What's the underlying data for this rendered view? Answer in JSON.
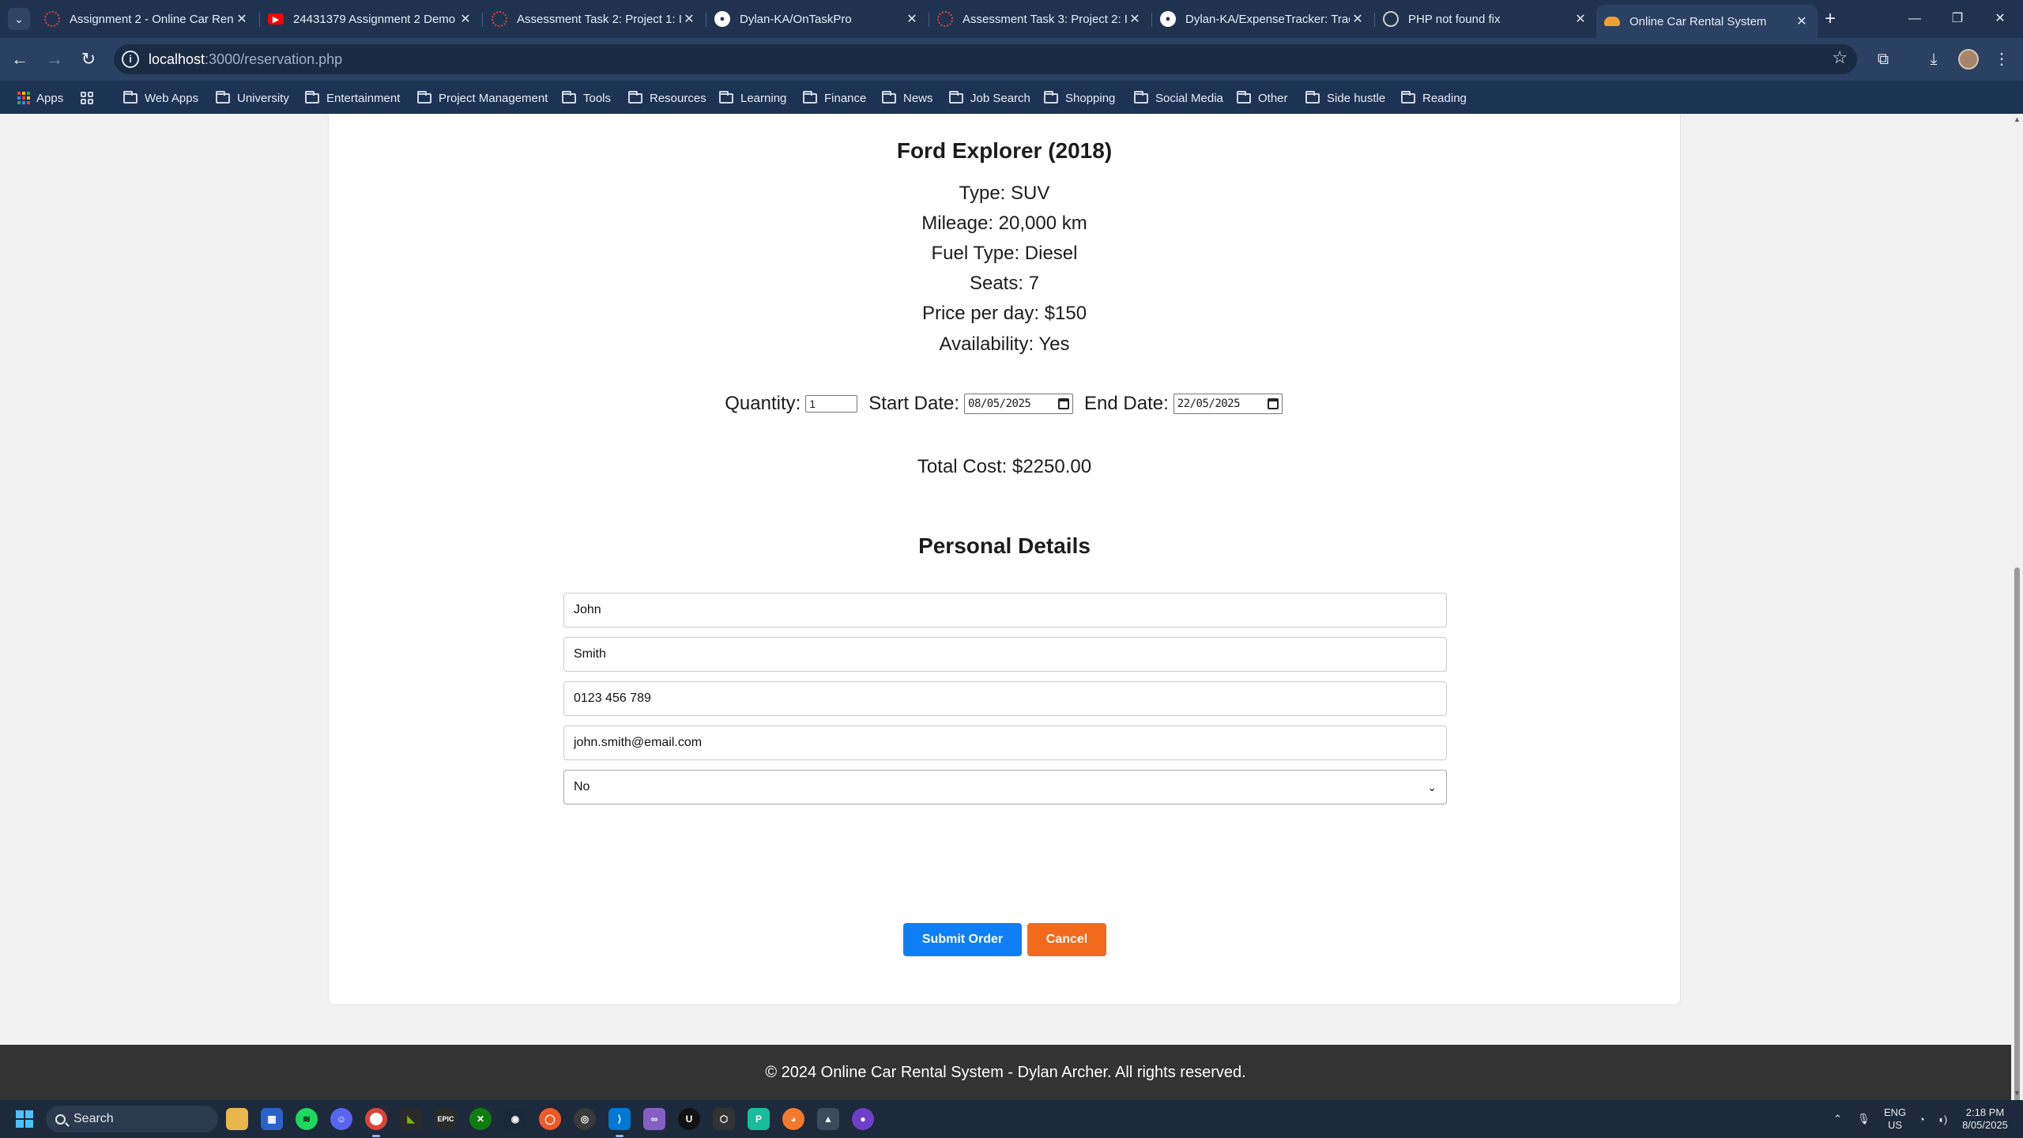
{
  "browser": {
    "tabs": [
      {
        "label": "Assignment 2 - Online Car Ren",
        "icon": "spinner-icon",
        "color": "#e04040"
      },
      {
        "label": "24431379 Assignment 2 Demo",
        "icon": "youtube-icon",
        "color": "#ff0000"
      },
      {
        "label": "Assessment Task 2: Project 1: I",
        "icon": "spinner-icon",
        "color": "#e04040"
      },
      {
        "label": "Dylan-KA/OnTaskPro",
        "icon": "github-icon",
        "color": "#ffffff"
      },
      {
        "label": "Assessment Task 3: Project 2: I",
        "icon": "spinner-icon",
        "color": "#e04040"
      },
      {
        "label": "Dylan-KA/ExpenseTracker: Trac",
        "icon": "github-icon",
        "color": "#ffffff"
      },
      {
        "label": "PHP not found fix",
        "icon": "chatgpt-icon",
        "color": "#cccccc"
      },
      {
        "label": "Online Car Rental System",
        "icon": "car-icon",
        "color": "#f0a030"
      }
    ],
    "url_host": "localhost",
    "url_path": ":3000/reservation.php",
    "bookmarks": {
      "apps_label": "Apps",
      "folders": [
        "Web Apps",
        "University",
        "Entertainment",
        "Project Management",
        "Tools",
        "Resources",
        "Learning",
        "Finance",
        "News",
        "Job Search",
        "Shopping",
        "Social Media",
        "Other",
        "Side hustle",
        "Reading"
      ]
    }
  },
  "car": {
    "title": "Ford Explorer (2018)",
    "type": "Type: SUV",
    "mileage": "Mileage: 20,000 km",
    "fuel": "Fuel Type: Diesel",
    "seats": "Seats: 7",
    "price": "Price per day: $150",
    "availability": "Availability: Yes"
  },
  "order": {
    "quantity_label": "Quantity:",
    "quantity_value": "1",
    "start_label": "Start Date:",
    "start_value": "08/05/2025",
    "end_label": "End Date:",
    "end_value": "22/05/2025",
    "total": "Total Cost: $2250.00"
  },
  "personal": {
    "title": "Personal Details",
    "first_name": "John",
    "last_name": "Smith",
    "phone": "0123 456 789",
    "email": "john.smith@email.com",
    "license_select": "No"
  },
  "buttons": {
    "submit": "Submit Order",
    "cancel": "Cancel"
  },
  "footer": {
    "text": "© 2024 Online Car Rental System - Dylan Archer. All rights reserved."
  },
  "taskbar": {
    "search_label": "Search",
    "lang_top": "ENG",
    "lang_bottom": "US",
    "time": "2:18 PM",
    "date": "8/05/2025"
  },
  "colors": {
    "submit": "#0f7ff5",
    "cancel": "#f26a1b",
    "footer": "#333333",
    "browser_chrome": "#1f3350"
  }
}
